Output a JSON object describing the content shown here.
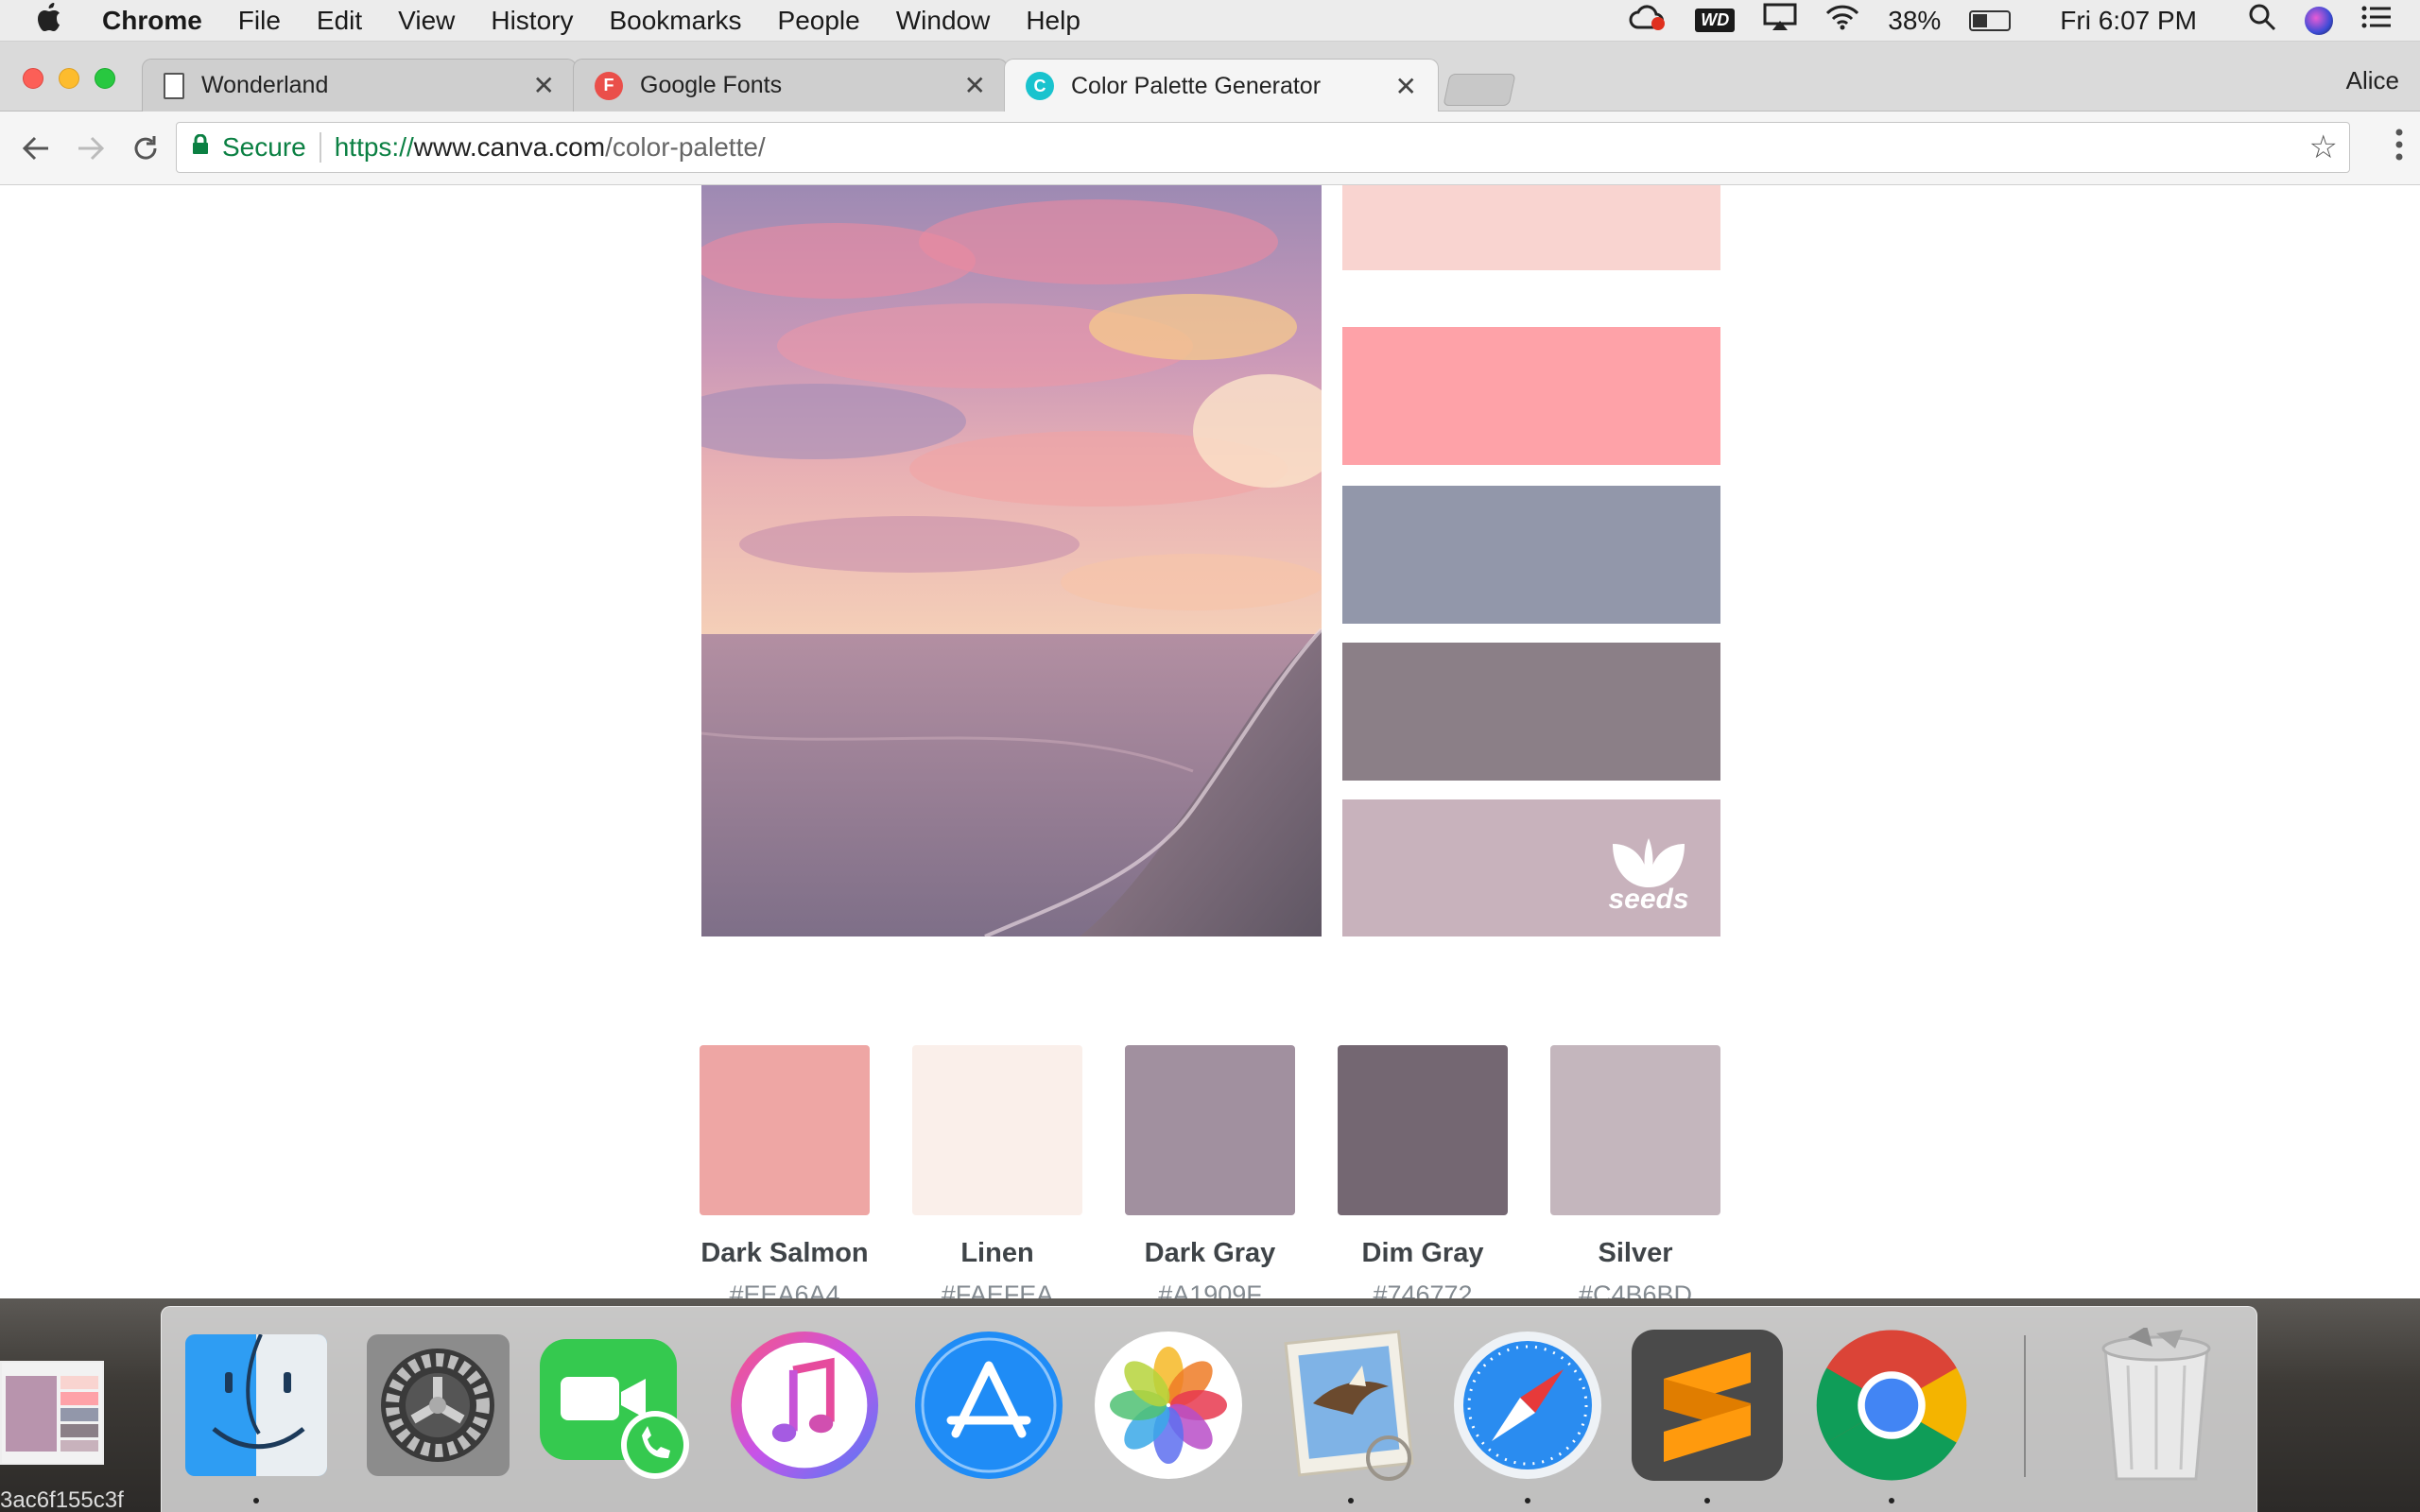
{
  "menubar": {
    "app_name": "Chrome",
    "menus": [
      "File",
      "Edit",
      "View",
      "History",
      "Bookmarks",
      "People",
      "Window",
      "Help"
    ],
    "battery": "38%",
    "clock": "Fri 6:07 PM",
    "wd_label": "WD"
  },
  "browser": {
    "tabs": [
      {
        "title": "Wonderland",
        "favicon": "document-icon",
        "active": false
      },
      {
        "title": "Google Fonts",
        "favicon": "F",
        "active": false
      },
      {
        "title": "Color Palette Generator",
        "favicon": "C",
        "active": true
      }
    ],
    "profile_name": "Alice",
    "address": {
      "secure_label": "Secure",
      "scheme": "https://",
      "host": "www.canva.com",
      "path": "/color-palette/"
    }
  },
  "reference": {
    "strip_colors": [
      "#F9D4D0",
      "#FEA2A8",
      "#9297AA",
      "#8B7F87",
      "#C8B2BC"
    ],
    "logo_text": "seeds"
  },
  "palette": [
    {
      "name": "Dark Salmon",
      "hex": "#EEA6A4"
    },
    {
      "name": "Linen",
      "hex": "#FAEFEA"
    },
    {
      "name": "Dark Gray",
      "hex": "#A1909F"
    },
    {
      "name": "Dim Gray",
      "hex": "#746772"
    },
    {
      "name": "Silver",
      "hex": "#C4B6BD"
    }
  ],
  "dock": {
    "apps": [
      "finder-icon",
      "system-preferences-icon",
      "facetime-icon",
      "itunes-icon",
      "app-store-icon",
      "photos-icon",
      "mail-icon",
      "safari-icon",
      "sublime-text-icon",
      "chrome-icon",
      "trash-icon"
    ],
    "thumbnail_label": "3ac6f155c3f"
  }
}
